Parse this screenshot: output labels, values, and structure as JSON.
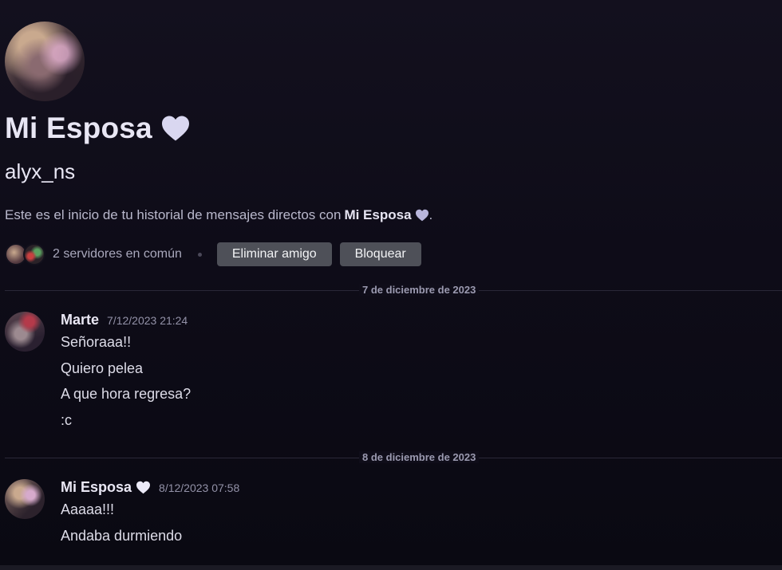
{
  "profile": {
    "display_name": "Mi Esposa",
    "username": "alyx_ns",
    "intro_text": "Este es el inicio de tu historial de mensajes directos con",
    "intro_name": "Mi Esposa",
    "intro_end": ".",
    "mutual_servers": "2 servidores en común",
    "remove_friend": "Eliminar amigo",
    "block": "Bloquear"
  },
  "colors": {
    "heart": "#d9d7f0",
    "button": "#4e5058",
    "background": "#0f0d19"
  },
  "dividers": [
    "7 de diciembre de 2023",
    "8 de diciembre de 2023"
  ],
  "messages": [
    {
      "author": "Marte",
      "timestamp": "7/12/2023 21:24",
      "lines": [
        "Señoraaa!!",
        "Quiero pelea",
        "A que hora regresa?",
        ":c"
      ]
    },
    {
      "author": "Mi Esposa",
      "timestamp": "8/12/2023 07:58",
      "lines": [
        "Aaaaa!!!",
        "Andaba durmiendo"
      ]
    }
  ]
}
